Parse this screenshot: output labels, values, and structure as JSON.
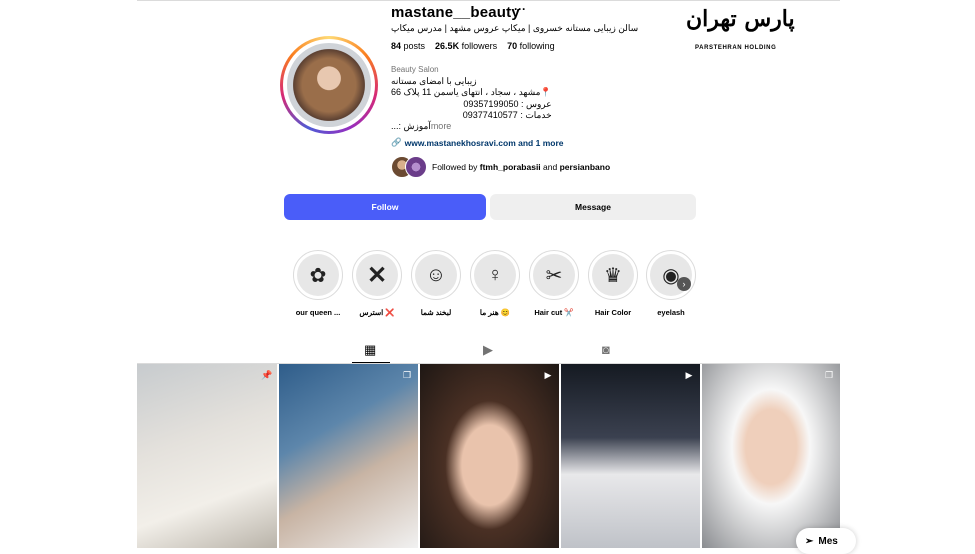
{
  "profile": {
    "username": "mastane__beauty",
    "more_icon": "more-horizontal-icon",
    "subtitle": "سالن زیبایی مستانه خسروی | میکاپ عروس مشهد | مدرس میکاپ",
    "stats": {
      "posts_count": "84",
      "posts_label": "posts",
      "followers_count": "26.5K",
      "followers_label": "followers",
      "following_count": "70",
      "following_label": "following"
    },
    "category": "Beauty Salon",
    "bio_lines": [
      "زیبایی با امضای مستانه",
      "📍مشهد ، سجاد ، انتهای یاسمن 11 پلاک 66",
      "عروس : 09357199050",
      "خدمات : 09377410577",
      "آموزش :..."
    ],
    "bio_more": "more",
    "link_text": "www.mastanekhosravi.com and 1 more",
    "followed_by_prefix": "Followed by",
    "followed_by_user1": "ftmh_porabasii",
    "followed_by_and": "and",
    "followed_by_user2": "persianbano"
  },
  "actions": {
    "follow_label": "Follow",
    "message_label": "Message"
  },
  "logo": {
    "script_text": "پارس تهران",
    "sub_text": "PARSTEHRAN HOLDING"
  },
  "highlights": [
    {
      "label": "our queen ...",
      "icon": "flowers-icon",
      "glyph": "✿"
    },
    {
      "label": "استرس ❌",
      "icon": "x-icon",
      "glyph": "✕"
    },
    {
      "label": "لبخند شما",
      "icon": "smile-sketch-icon",
      "glyph": "☺"
    },
    {
      "label": "هنر ما 😊",
      "icon": "woman-sketch-icon",
      "glyph": "♀"
    },
    {
      "label": "Hair cut ✂️",
      "icon": "scissors-icon",
      "glyph": "✂"
    },
    {
      "label": "Hair Color",
      "icon": "woman-profile-icon",
      "glyph": "♛"
    },
    {
      "label": "eyelash",
      "icon": "eyelash-icon",
      "glyph": "◉"
    }
  ],
  "tabs": [
    {
      "name": "posts",
      "icon": "grid-icon",
      "glyph": "▦"
    },
    {
      "name": "reels",
      "icon": "reels-icon",
      "glyph": "▶"
    },
    {
      "name": "tagged",
      "icon": "tagged-icon",
      "glyph": "◙"
    }
  ],
  "posts": [
    {
      "badge_icon": "pin-icon",
      "badge_glyph": "📌"
    },
    {
      "badge_icon": "carousel-icon",
      "badge_glyph": "❐"
    },
    {
      "badge_icon": "reel-icon",
      "badge_glyph": "▶"
    },
    {
      "badge_icon": "reel-icon",
      "badge_glyph": "▶"
    },
    {
      "badge_icon": "carousel-icon",
      "badge_glyph": "❐"
    }
  ],
  "floating_message": {
    "label": "Mes",
    "icon": "send-icon"
  },
  "colors": {
    "follow_button": "#4a5df9",
    "message_button": "#efefef",
    "secondary_text": "#737373",
    "link": "#00376b"
  }
}
